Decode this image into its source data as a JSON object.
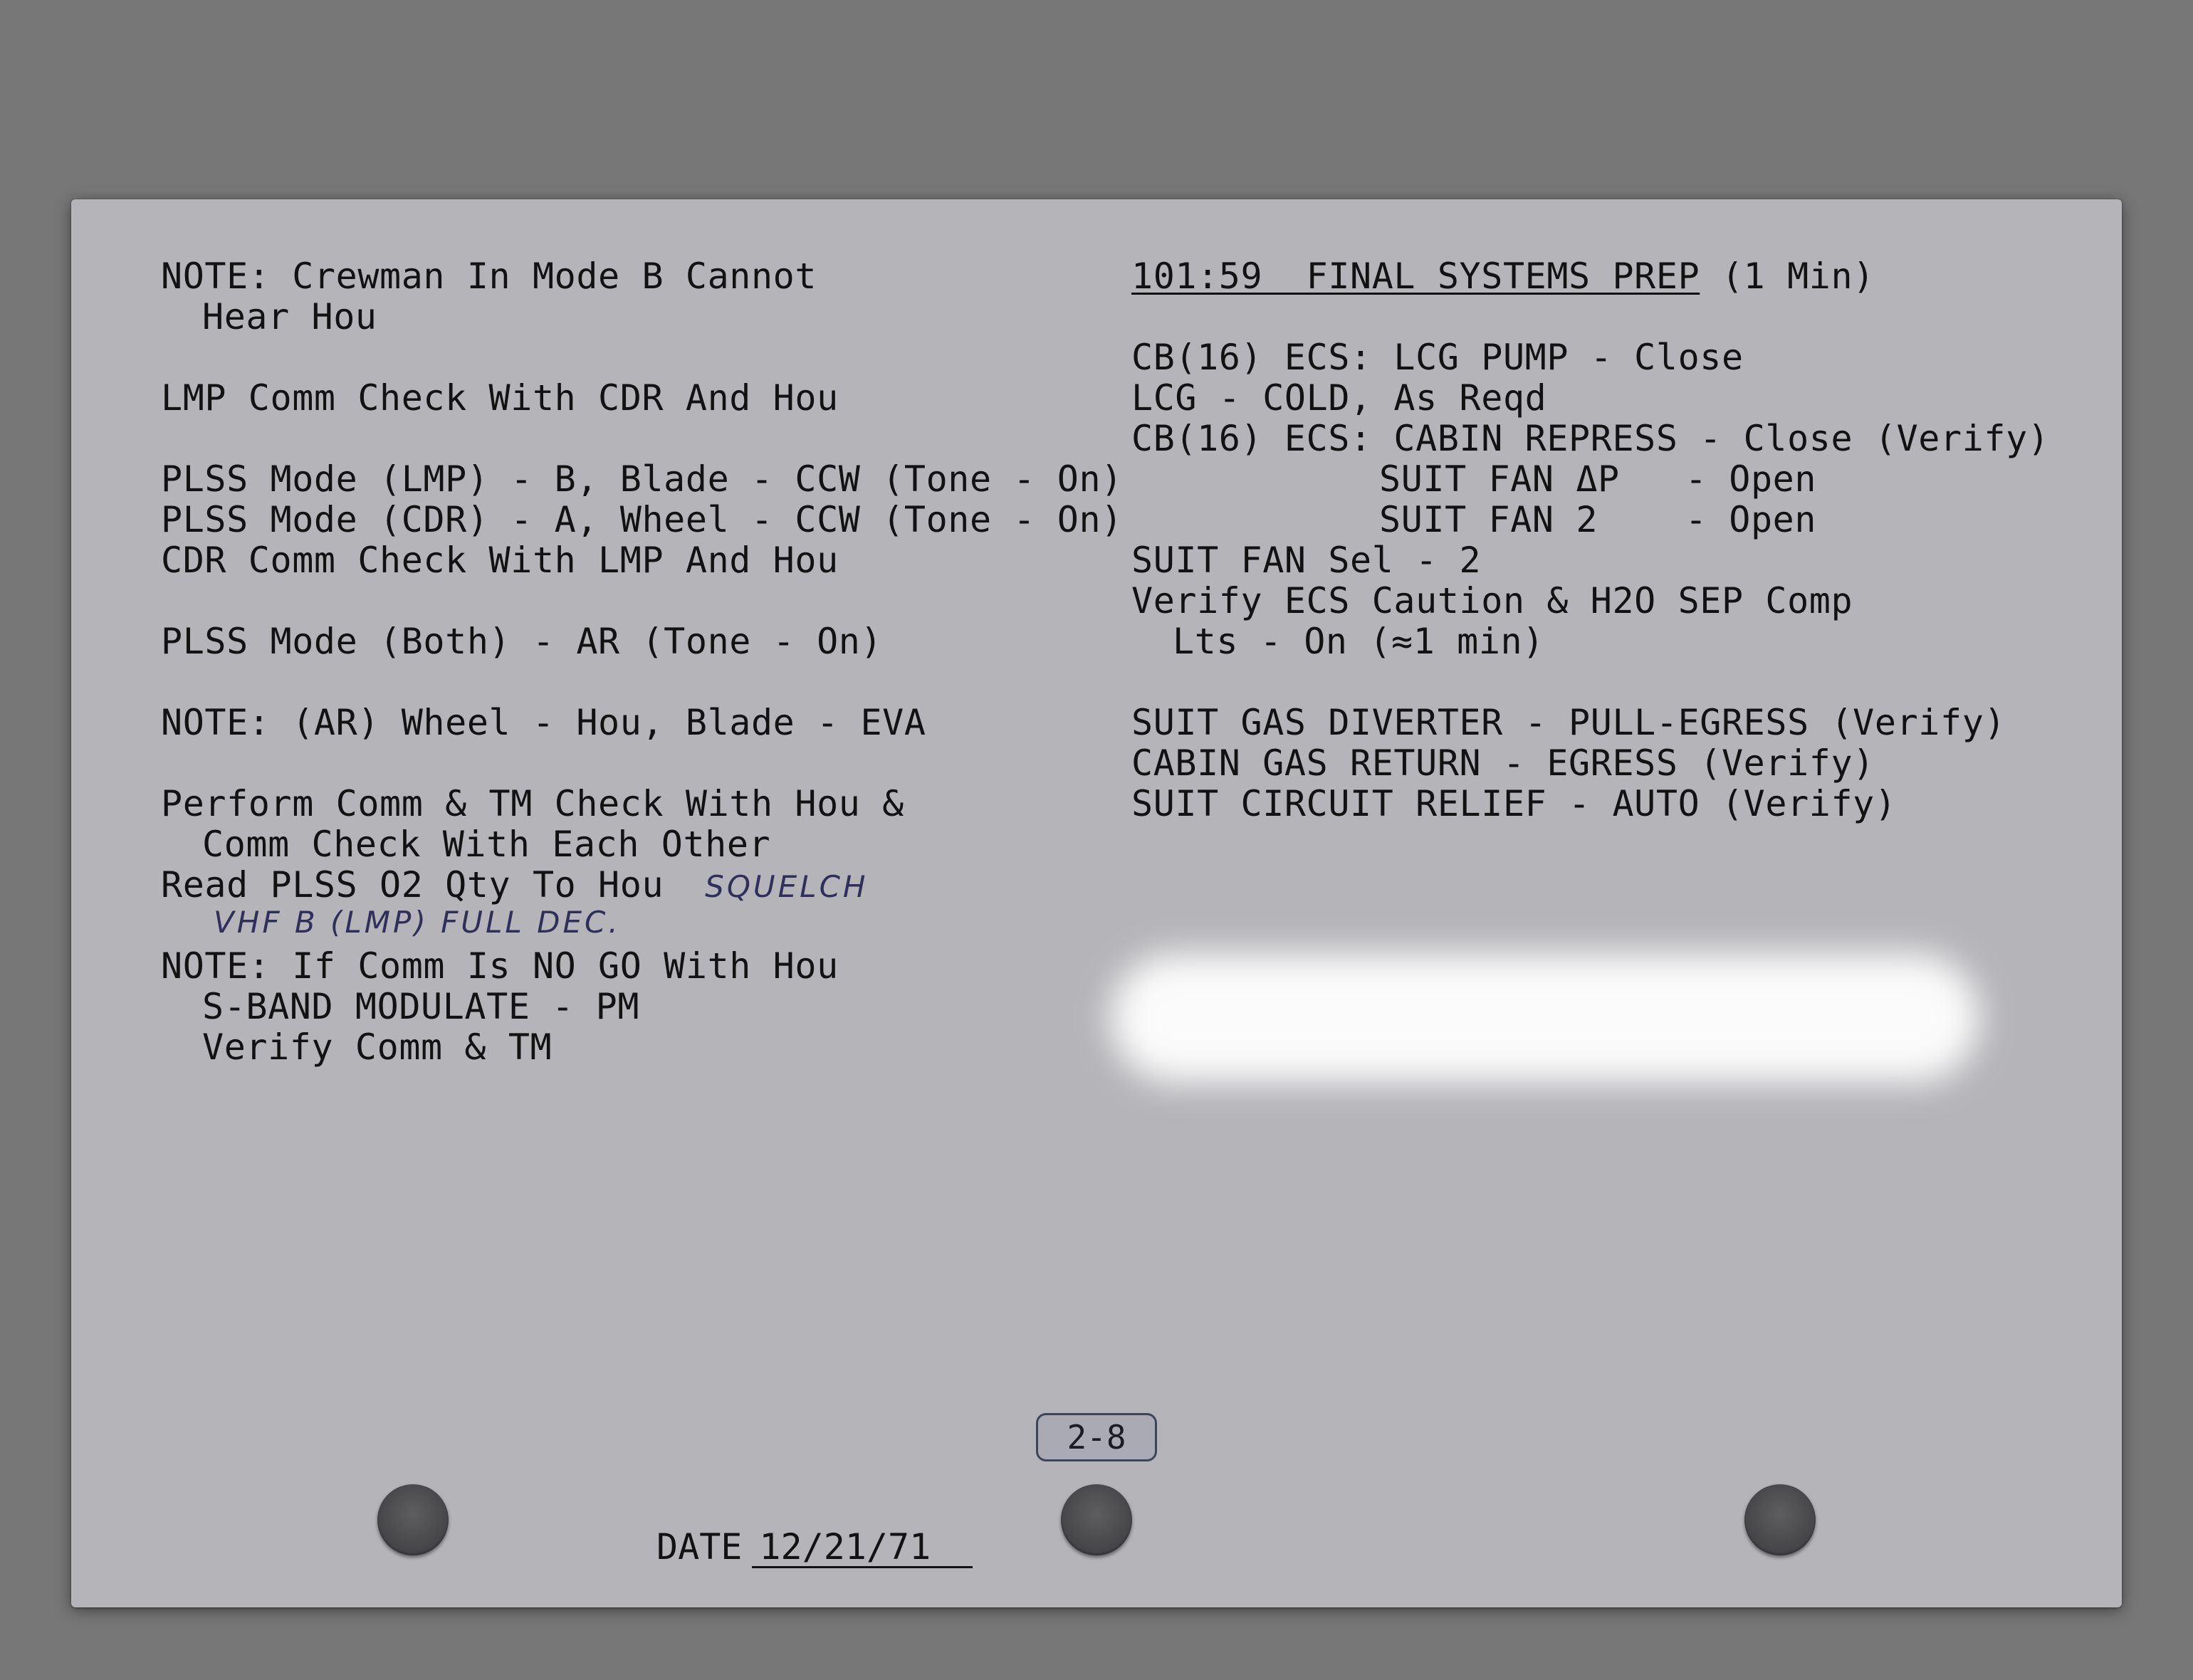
{
  "left_column": {
    "note1_l1": "NOTE: Crewman In Mode B Cannot",
    "note1_l2": "Hear Hou",
    "lmp_comm": "LMP Comm Check With CDR And Hou",
    "plss_lmp": "PLSS Mode (LMP) - B, Blade - CCW (Tone - On)",
    "plss_cdr": "PLSS Mode (CDR) - A, Wheel - CCW (Tone - On)",
    "cdr_comm": "CDR Comm Check With LMP And Hou",
    "plss_both": "PLSS Mode (Both) - AR (Tone - On)",
    "note2": "NOTE: (AR) Wheel - Hou, Blade - EVA",
    "perform_l1": "Perform Comm & TM Check With Hou &",
    "perform_l2": "Comm Check With Each Other",
    "read_plss": "Read PLSS O2 Qty To Hou",
    "hand_squelch": "SQUELCH",
    "hand_vhf": "VHF B (LMP) FULL DEC.",
    "note3_l1": "NOTE: If Comm Is NO GO With Hou",
    "note3_l2": "S-BAND MODULATE - PM",
    "note3_l3": "Verify Comm & TM"
  },
  "right_column": {
    "header_time_title": "101:59  FINAL SYSTEMS PREP",
    "header_duration": " (1 Min)",
    "cb_lcg": "CB(16) ECS: LCG PUMP - Close",
    "lcg_cold": "LCG - COLD, As Reqd",
    "cb_cabin": "CB(16) ECS: CABIN REPRESS - Close (Verify)",
    "suit_fan_dp": "SUIT FAN ΔP   - Open",
    "suit_fan_2": "SUIT FAN 2    - Open",
    "suit_fan_sel": "SUIT FAN Sel - 2",
    "verify_ecs_l1": "Verify ECS Caution & H2O SEP Comp",
    "verify_ecs_l2": "Lts - On (≈1 min)",
    "suit_gas": "SUIT GAS DIVERTER - PULL-EGRESS (Verify)",
    "cabin_gas": "CABIN GAS RETURN - EGRESS (Verify)",
    "suit_circuit": "SUIT CIRCUIT RELIEF - AUTO (Verify)"
  },
  "footer": {
    "page_number": "2-8",
    "date_label": "DATE",
    "date_value": "12/21/71"
  }
}
